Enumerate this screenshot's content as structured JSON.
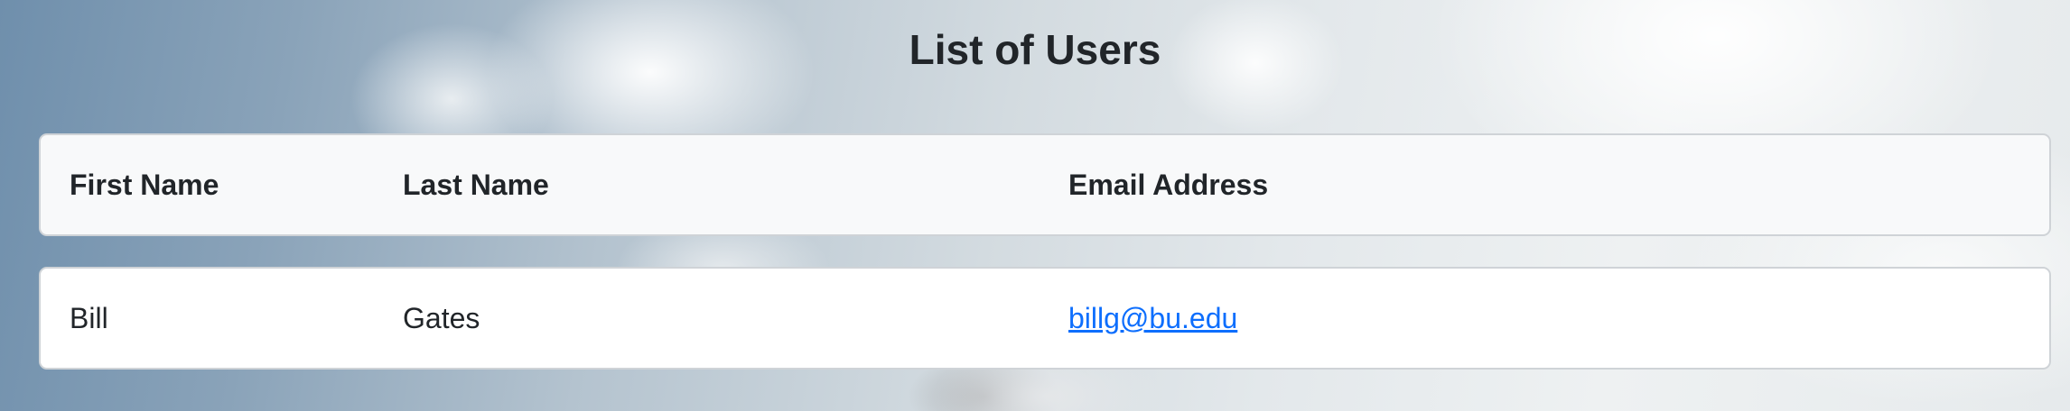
{
  "page": {
    "title": "List of Users"
  },
  "table": {
    "headers": [
      "First Name",
      "Last Name",
      "Email Address"
    ],
    "rows": [
      {
        "first_name": "Bill",
        "last_name": "Gates",
        "email": "billg@bu.edu"
      }
    ]
  },
  "colors": {
    "text": "#212529",
    "header_background": "#f8f9fa",
    "row_background": "#ffffff",
    "link": "#0d6efd",
    "border": "#cfd3d7"
  }
}
